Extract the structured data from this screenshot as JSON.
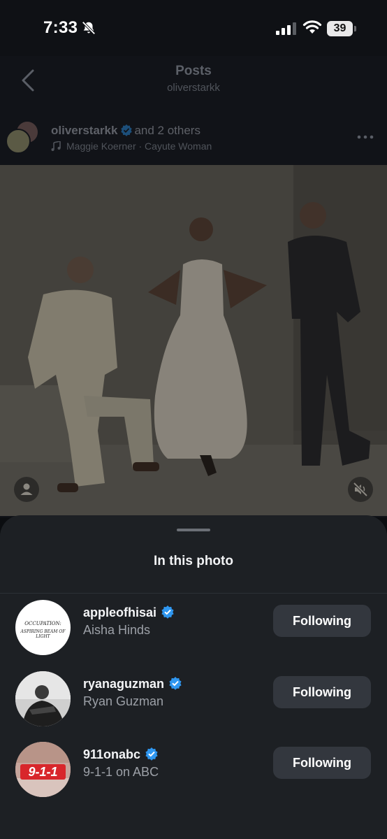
{
  "status_bar": {
    "time": "7:33",
    "battery": "39"
  },
  "header": {
    "title": "Posts",
    "subtitle": "oliverstarkk"
  },
  "post": {
    "author": "oliverstarkk",
    "collaborators": "and 2 others",
    "music": "Maggie Koerner · Cayute Woman"
  },
  "sheet": {
    "title": "In this photo",
    "tagged_users": [
      {
        "handle": "appleofhisai",
        "name": "Aisha Hinds",
        "button": "Following",
        "verified": true,
        "avatar_text_1": "OCCUPATION:",
        "avatar_text_2": "ASPIRING BEAM OF LIGHT"
      },
      {
        "handle": "ryanaguzman",
        "name": "Ryan Guzman",
        "button": "Following",
        "verified": true
      },
      {
        "handle": "911onabc",
        "name": "9-1-1 on ABC",
        "button": "Following",
        "verified": true,
        "avatar_text_1": "9-1-1"
      }
    ]
  },
  "colors": {
    "verified": "#2f97f0",
    "sheet_bg": "#1d2024",
    "button_bg": "#33373e",
    "brand_911": "#d8262b"
  },
  "icons": [
    "bell-slash-icon",
    "signal-icon",
    "wifi-icon",
    "back-chevron-icon",
    "verified-badge-icon",
    "music-note-icon",
    "more-icon",
    "person-tag-icon",
    "speaker-muted-icon"
  ]
}
